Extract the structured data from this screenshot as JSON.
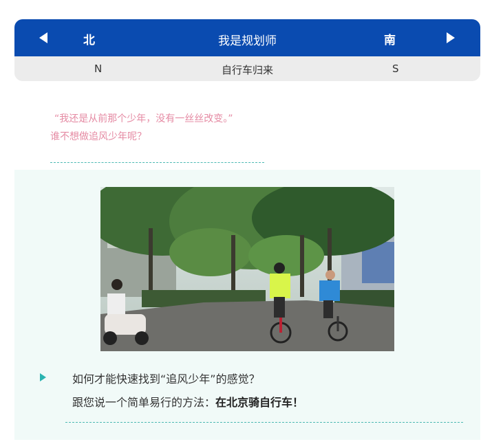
{
  "header": {
    "left_label": "北",
    "title": "我是规划师",
    "right_label": "南",
    "prev_icon": "triangle-left-icon",
    "next_icon": "triangle-right-icon",
    "accent": "#0a4bb0"
  },
  "subheader": {
    "left": "N",
    "center": "自行车归来",
    "right": "S"
  },
  "quote": {
    "line1": "“我还是从前那个少年，没有一丝丝改变。”",
    "line2": "谁不想做追风少年呢？",
    "color": "#e58aa3"
  },
  "section": {
    "bullet_icon": "triangle-bullet-icon",
    "line1": "如何才能快速找到“追风少年”的感觉？",
    "line2_prefix": "跟您说一个简单易行的方法：",
    "line2_bold": "在北京骑自行车！",
    "accent": "#2ab3b0"
  }
}
